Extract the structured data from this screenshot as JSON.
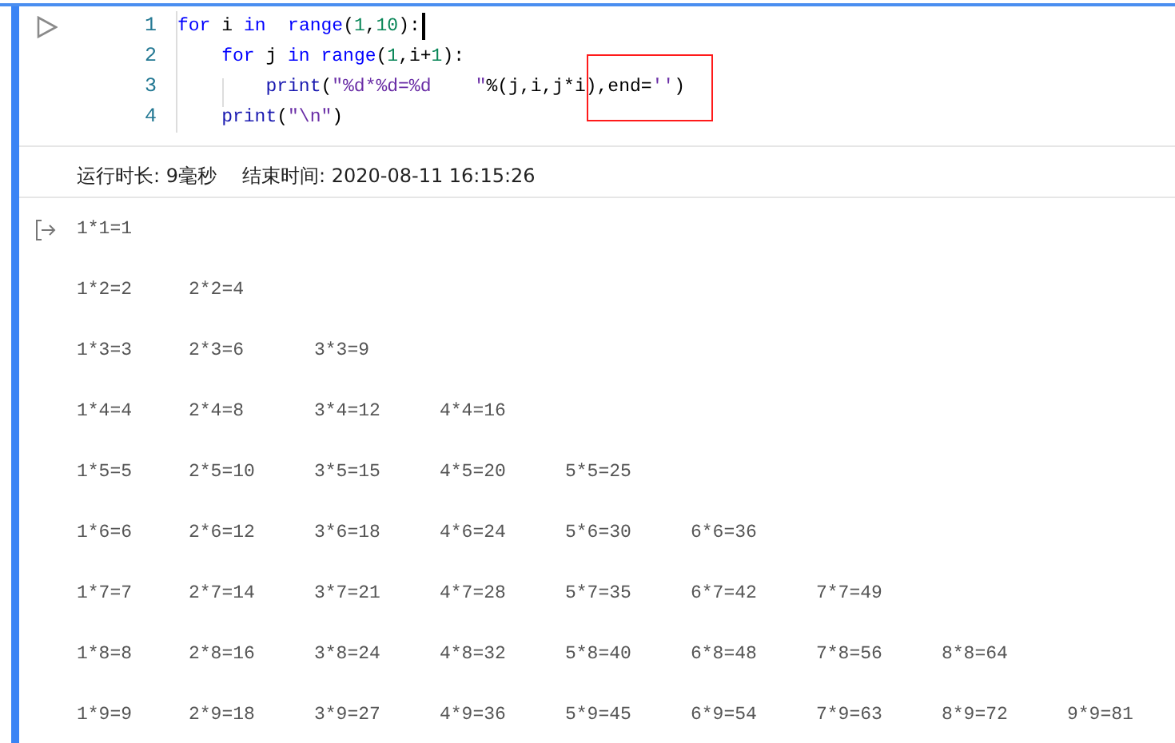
{
  "code_cell": {
    "line_numbers": [
      "1",
      "2",
      "3",
      "4"
    ],
    "lines": [
      [
        {
          "kind": "kw",
          "text": "for"
        },
        {
          "kind": "plain",
          "text": " i "
        },
        {
          "kind": "kw",
          "text": "in  range"
        },
        {
          "kind": "plain",
          "text": "("
        },
        {
          "kind": "num",
          "text": "1"
        },
        {
          "kind": "plain",
          "text": ","
        },
        {
          "kind": "num",
          "text": "10"
        },
        {
          "kind": "plain",
          "text": "):"
        }
      ],
      [
        {
          "kind": "kw",
          "text": "    for"
        },
        {
          "kind": "plain",
          "text": " j "
        },
        {
          "kind": "kw",
          "text": "in range"
        },
        {
          "kind": "plain",
          "text": "("
        },
        {
          "kind": "num",
          "text": "1"
        },
        {
          "kind": "plain",
          "text": ",i+"
        },
        {
          "kind": "num",
          "text": "1"
        },
        {
          "kind": "plain",
          "text": "):"
        }
      ],
      [
        {
          "kind": "fn",
          "text": "        print"
        },
        {
          "kind": "plain",
          "text": "("
        },
        {
          "kind": "str",
          "text": "\"%d*%d=%d    \""
        },
        {
          "kind": "plain",
          "text": "%(j,i,j*i),end="
        },
        {
          "kind": "str",
          "text": "''"
        },
        {
          "kind": "plain",
          "text": ")"
        }
      ],
      [
        {
          "kind": "fn",
          "text": "    print"
        },
        {
          "kind": "plain",
          "text": "("
        },
        {
          "kind": "str",
          "text": "\"\\n\""
        },
        {
          "kind": "plain",
          "text": ")"
        }
      ]
    ]
  },
  "run_info": {
    "duration": "运行时长: 9毫秒",
    "end_time": "结束时间: 2020-08-11 16:15:26"
  },
  "output": [
    [
      "1*1=1"
    ],
    [
      "1*2=2",
      "2*2=4"
    ],
    [
      "1*3=3",
      "2*3=6",
      "3*3=9"
    ],
    [
      "1*4=4",
      "2*4=8",
      "3*4=12",
      "4*4=16"
    ],
    [
      "1*5=5",
      "2*5=10",
      "3*5=15",
      "4*5=20",
      "5*5=25"
    ],
    [
      "1*6=6",
      "2*6=12",
      "3*6=18",
      "4*6=24",
      "5*6=30",
      "6*6=36"
    ],
    [
      "1*7=7",
      "2*7=14",
      "3*7=21",
      "4*7=28",
      "5*7=35",
      "6*7=42",
      "7*7=49"
    ],
    [
      "1*8=8",
      "2*8=16",
      "3*8=24",
      "4*8=32",
      "5*8=40",
      "6*8=48",
      "7*8=56",
      "8*8=64"
    ],
    [
      "1*9=9",
      "2*9=18",
      "3*9=27",
      "4*9=36",
      "5*9=45",
      "6*9=54",
      "7*9=63",
      "8*9=72",
      "9*9=81"
    ]
  ]
}
